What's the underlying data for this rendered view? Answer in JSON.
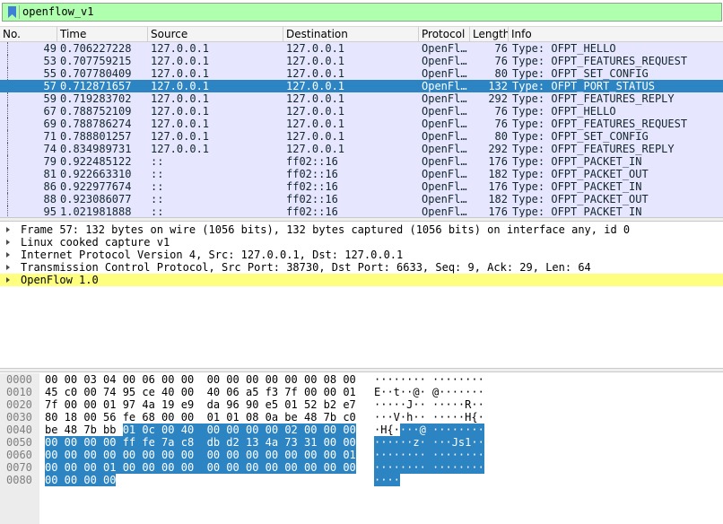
{
  "filter": {
    "value": "openflow_v1",
    "bookmark_icon": "bookmark-icon"
  },
  "columns": [
    "No.",
    "Time",
    "Source",
    "Destination",
    "Protocol",
    "Length",
    "Info"
  ],
  "packets": [
    {
      "no": "49",
      "time": "0.706227228",
      "src": "127.0.0.1",
      "dst": "127.0.0.1",
      "proto": "OpenFl…",
      "len": "76",
      "info": "Type: OFPT_HELLO",
      "selected": false
    },
    {
      "no": "53",
      "time": "0.707759215",
      "src": "127.0.0.1",
      "dst": "127.0.0.1",
      "proto": "OpenFl…",
      "len": "76",
      "info": "Type: OFPT_FEATURES_REQUEST",
      "selected": false
    },
    {
      "no": "55",
      "time": "0.707780409",
      "src": "127.0.0.1",
      "dst": "127.0.0.1",
      "proto": "OpenFl…",
      "len": "80",
      "info": "Type: OFPT_SET_CONFIG",
      "selected": false
    },
    {
      "no": "57",
      "time": "0.712871657",
      "src": "127.0.0.1",
      "dst": "127.0.0.1",
      "proto": "OpenFl…",
      "len": "132",
      "info": "Type: OFPT_PORT_STATUS",
      "selected": true
    },
    {
      "no": "59",
      "time": "0.719283702",
      "src": "127.0.0.1",
      "dst": "127.0.0.1",
      "proto": "OpenFl…",
      "len": "292",
      "info": "Type: OFPT_FEATURES_REPLY",
      "selected": false
    },
    {
      "no": "67",
      "time": "0.788752109",
      "src": "127.0.0.1",
      "dst": "127.0.0.1",
      "proto": "OpenFl…",
      "len": "76",
      "info": "Type: OFPT_HELLO",
      "selected": false
    },
    {
      "no": "69",
      "time": "0.788786274",
      "src": "127.0.0.1",
      "dst": "127.0.0.1",
      "proto": "OpenFl…",
      "len": "76",
      "info": "Type: OFPT_FEATURES_REQUEST",
      "selected": false
    },
    {
      "no": "71",
      "time": "0.788801257",
      "src": "127.0.0.1",
      "dst": "127.0.0.1",
      "proto": "OpenFl…",
      "len": "80",
      "info": "Type: OFPT_SET_CONFIG",
      "selected": false
    },
    {
      "no": "74",
      "time": "0.834989731",
      "src": "127.0.0.1",
      "dst": "127.0.0.1",
      "proto": "OpenFl…",
      "len": "292",
      "info": "Type: OFPT_FEATURES_REPLY",
      "selected": false
    },
    {
      "no": "79",
      "time": "0.922485122",
      "src": "::",
      "dst": "ff02::16",
      "proto": "OpenFl…",
      "len": "176",
      "info": "Type: OFPT_PACKET_IN",
      "selected": false
    },
    {
      "no": "81",
      "time": "0.922663310",
      "src": "::",
      "dst": "ff02::16",
      "proto": "OpenFl…",
      "len": "182",
      "info": "Type: OFPT_PACKET_OUT",
      "selected": false
    },
    {
      "no": "86",
      "time": "0.922977674",
      "src": "::",
      "dst": "ff02::16",
      "proto": "OpenFl…",
      "len": "176",
      "info": "Type: OFPT_PACKET_IN",
      "selected": false
    },
    {
      "no": "88",
      "time": "0.923086077",
      "src": "::",
      "dst": "ff02::16",
      "proto": "OpenFl…",
      "len": "182",
      "info": "Type: OFPT_PACKET_OUT",
      "selected": false
    },
    {
      "no": "95",
      "time": "1.021981888",
      "src": "::",
      "dst": "ff02::16",
      "proto": "OpenFl…",
      "len": "176",
      "info": "Type: OFPT_PACKET_IN",
      "selected": false
    }
  ],
  "details": [
    {
      "text": "Frame 57: 132 bytes on wire (1056 bits), 132 bytes captured (1056 bits) on interface any, id 0",
      "highlighted": false
    },
    {
      "text": "Linux cooked capture v1",
      "highlighted": false
    },
    {
      "text": "Internet Protocol Version 4, Src: 127.0.0.1, Dst: 127.0.0.1",
      "highlighted": false
    },
    {
      "text": "Transmission Control Protocol, Src Port: 38730, Dst Port: 6633, Seq: 9, Ack: 29, Len: 64",
      "highlighted": false
    },
    {
      "text": "OpenFlow 1.0",
      "highlighted": true
    }
  ],
  "bytes": [
    {
      "offset": "0000",
      "hex": "00 00 03 04 00 06 00 00  00 00 00 00 00 00 08 00",
      "ascii": "········ ········",
      "hex_sel_from": -1,
      "hex_sel_to": -1,
      "asc_sel_from": -1,
      "asc_sel_to": -1
    },
    {
      "offset": "0010",
      "hex": "45 c0 00 74 95 ce 40 00  40 06 a5 f3 7f 00 00 01",
      "ascii": "E··t··@· @·······",
      "hex_sel_from": -1,
      "hex_sel_to": -1,
      "asc_sel_from": -1,
      "asc_sel_to": -1
    },
    {
      "offset": "0020",
      "hex": "7f 00 00 01 97 4a 19 e9  da 96 90 e5 01 52 b2 e7",
      "ascii": "·····J·· ·····R··",
      "hex_sel_from": -1,
      "hex_sel_to": -1,
      "asc_sel_from": -1,
      "asc_sel_to": -1
    },
    {
      "offset": "0030",
      "hex": "80 18 00 56 fe 68 00 00  01 01 08 0a be 48 7b c0",
      "ascii": "···V·h·· ·····H{·",
      "hex_sel_from": -1,
      "hex_sel_to": -1,
      "asc_sel_from": -1,
      "asc_sel_to": -1
    },
    {
      "offset": "0040",
      "hex": "be 48 7b bb 01 0c 00 40  00 00 00 00 02 00 00 00",
      "ascii": "·H{····@ ········",
      "hex_sel_from": 12,
      "hex_sel_to": 48,
      "asc_sel_from": 4,
      "asc_sel_to": 17
    },
    {
      "offset": "0050",
      "hex": "00 00 00 00 ff fe 7a c8  db d2 13 4a 73 31 00 00",
      "ascii": "······z· ···Js1··",
      "hex_sel_from": 0,
      "hex_sel_to": 48,
      "asc_sel_from": 0,
      "asc_sel_to": 17
    },
    {
      "offset": "0060",
      "hex": "00 00 00 00 00 00 00 00  00 00 00 00 00 00 00 01",
      "ascii": "········ ········",
      "hex_sel_from": 0,
      "hex_sel_to": 48,
      "asc_sel_from": 0,
      "asc_sel_to": 17
    },
    {
      "offset": "0070",
      "hex": "00 00 00 01 00 00 00 00  00 00 00 00 00 00 00 00",
      "ascii": "········ ········",
      "hex_sel_from": 0,
      "hex_sel_to": 48,
      "asc_sel_from": 0,
      "asc_sel_to": 17
    },
    {
      "offset": "0080",
      "hex": "00 00 00 00",
      "ascii": "····",
      "hex_sel_from": 0,
      "hex_sel_to": 11,
      "asc_sel_from": 0,
      "asc_sel_to": 4
    }
  ],
  "colors": {
    "filter_valid": "#afffaf",
    "row_bg": "#e7e6ff",
    "selection": "#2c84c3",
    "highlight": "#ffff7f"
  }
}
